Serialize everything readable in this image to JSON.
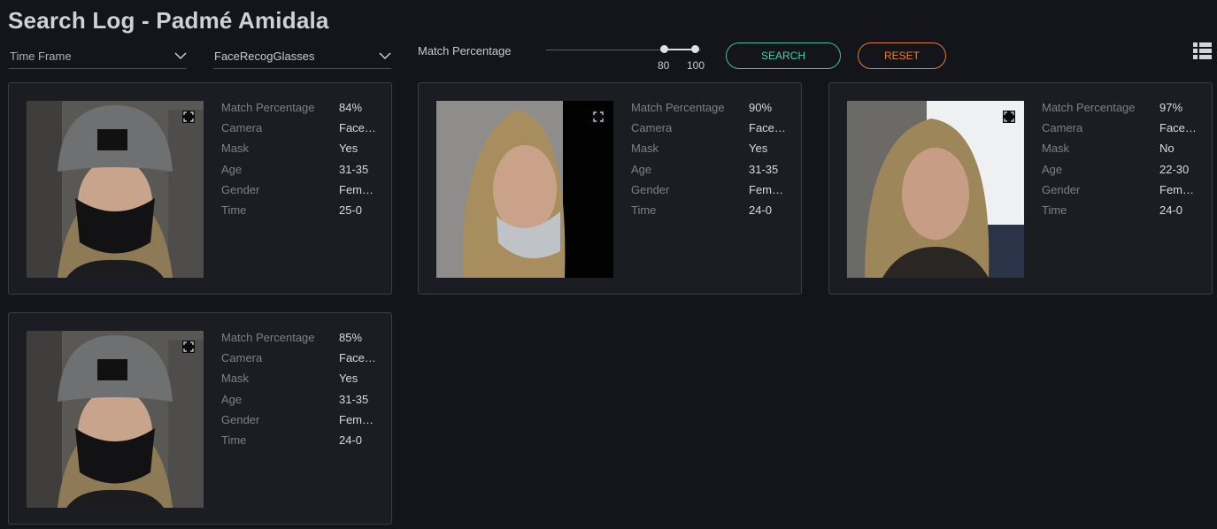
{
  "header": {
    "title": "Search Log - Padmé Amidala"
  },
  "filters": {
    "time_frame": "Time Frame",
    "camera": "FaceRecogGlasses",
    "match_label": "Match Percentage",
    "match_min": "80",
    "match_max": "100",
    "search_label": "SEARCH",
    "reset_label": "RESET"
  },
  "field_labels": {
    "match": "Match Percentage",
    "camera": "Camera",
    "mask": "Mask",
    "age": "Age",
    "gender": "Gender",
    "time": "Time"
  },
  "results": [
    {
      "match": "84%",
      "camera": "FaceRecogGlasses",
      "mask": "Yes",
      "age": "31-35",
      "gender": "Female",
      "time": "25-0"
    },
    {
      "match": "90%",
      "camera": "FaceRecogGlasses",
      "mask": "Yes",
      "age": "31-35",
      "gender": "Female",
      "time": "24-0"
    },
    {
      "match": "97%",
      "camera": "FaceRecogGlasses",
      "mask": "No",
      "age": "22-30",
      "gender": "Female",
      "time": "24-0"
    },
    {
      "match": "85%",
      "camera": "FaceRecogGlasses",
      "mask": "Yes",
      "age": "31-35",
      "gender": "Female",
      "time": "24-0"
    }
  ],
  "colors": {
    "search": "#3fd2ab",
    "reset": "#ee7f3a",
    "background": "#13151b"
  },
  "icons": [
    "chevron-down-icon",
    "list-view-icon",
    "expand-icon"
  ]
}
